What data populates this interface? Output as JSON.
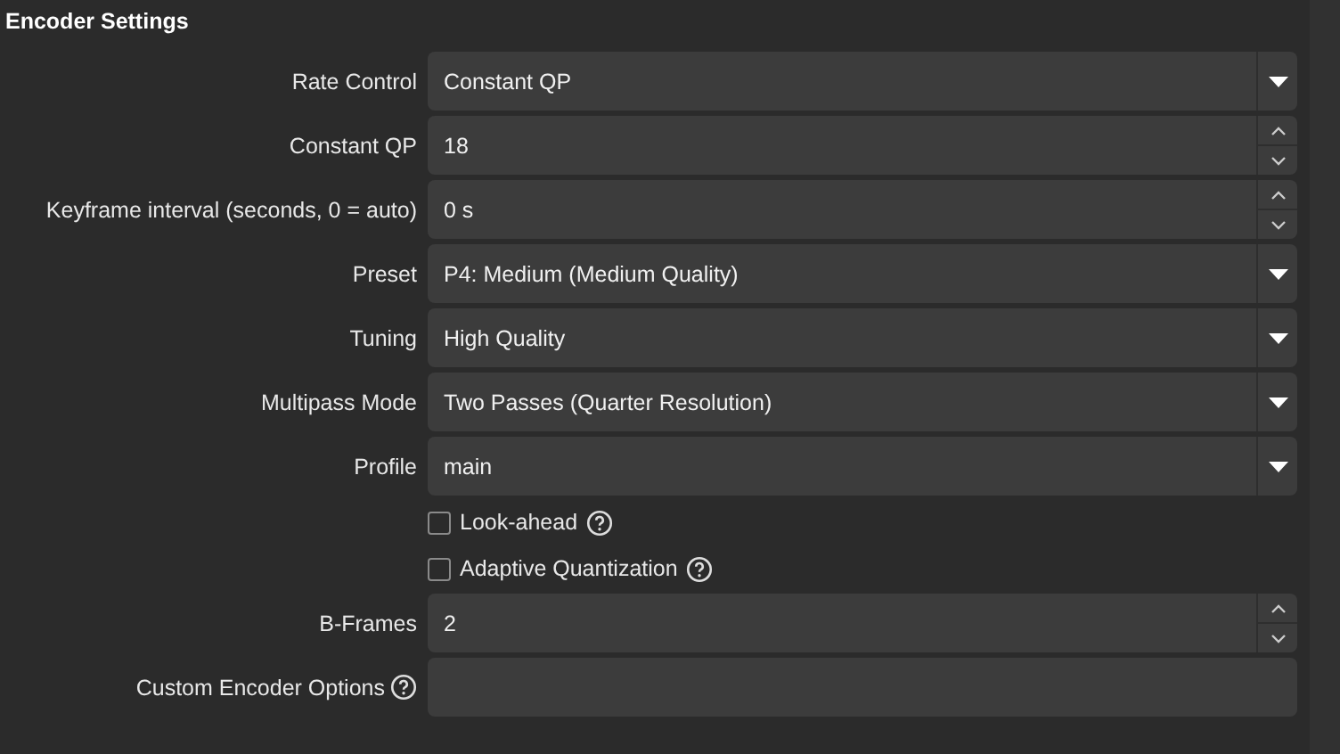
{
  "section": {
    "title": "Encoder Settings"
  },
  "rows": [
    {
      "kind": "select",
      "label": "Rate Control",
      "value": "Constant QP"
    },
    {
      "kind": "spin",
      "label": "Constant QP",
      "value": "18"
    },
    {
      "kind": "spin",
      "label": "Keyframe interval (seconds, 0 = auto)",
      "value": "0 s"
    },
    {
      "kind": "select",
      "label": "Preset",
      "value": "P4: Medium (Medium Quality)"
    },
    {
      "kind": "select",
      "label": "Tuning",
      "value": "High Quality"
    },
    {
      "kind": "select",
      "label": "Multipass Mode",
      "value": "Two Passes (Quarter Resolution)"
    },
    {
      "kind": "select",
      "label": "Profile",
      "value": "main"
    },
    {
      "kind": "checkbox",
      "label": "Look-ahead",
      "checked": false,
      "help": true
    },
    {
      "kind": "checkbox",
      "label": "Adaptive Quantization",
      "checked": false,
      "help": true
    },
    {
      "kind": "spin",
      "label": "B-Frames",
      "value": "2"
    },
    {
      "kind": "text",
      "label": "Custom Encoder Options",
      "help": true
    }
  ]
}
